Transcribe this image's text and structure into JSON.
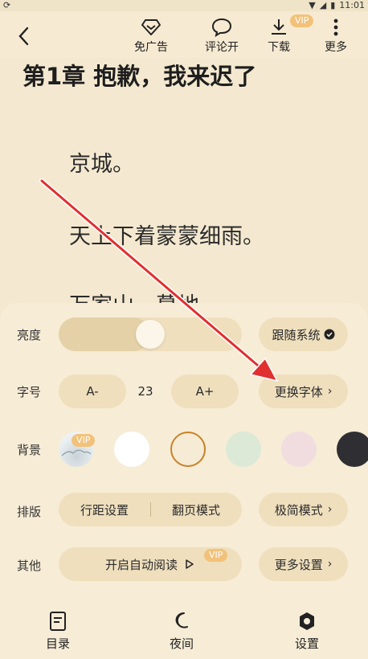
{
  "status": {
    "time": "11:01"
  },
  "toolbar": {
    "ad_free": "免广告",
    "comments": "评论开",
    "download": "下载",
    "download_badge": "VIP",
    "more": "更多"
  },
  "chapter": {
    "title": "第1章 抱歉，我来迟了",
    "paragraphs": [
      "京城。",
      "天上下着蒙蒙细雨。",
      "万家山，墓地"
    ]
  },
  "settings": {
    "brightness": {
      "label": "亮度",
      "level": 0.5,
      "follow_system": "跟随系统"
    },
    "font_size": {
      "label": "字号",
      "decrease": "A-",
      "value": "23",
      "increase": "A+",
      "change_font": "更换字体"
    },
    "background": {
      "label": "背景",
      "badge": "VIP",
      "colors": [
        "#ffffff",
        "#f6ecd5",
        "#dce9d6",
        "#f1dde0",
        "#2f2f33"
      ],
      "selected_index": 1
    },
    "layout": {
      "label": "排版",
      "line_spacing": "行距设置",
      "page_mode": "翻页模式",
      "simple_mode": "极简模式"
    },
    "other": {
      "label": "其他",
      "auto_read": "开启自动阅读",
      "auto_read_badge": "VIP",
      "more_settings": "更多设置"
    }
  },
  "nav": {
    "catalog": "目录",
    "night": "夜间",
    "settings": "设置"
  },
  "colors": {
    "accent": "#e03030",
    "panel": "#f7ecd6",
    "pill": "#efdfbd"
  }
}
